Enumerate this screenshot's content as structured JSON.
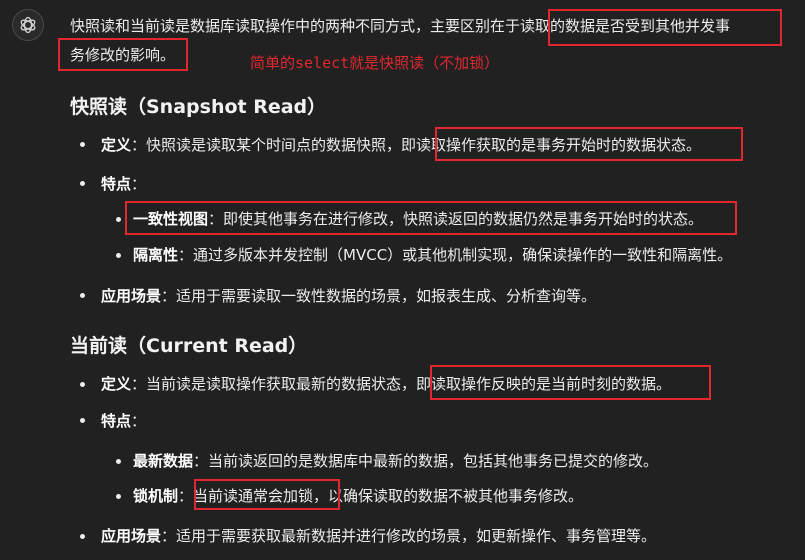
{
  "intro": {
    "line1": "快照读和当前读是数据库读取操作中的两种不同方式，主要区别在于读取的数据是否受到其他并发事",
    "line2": "务修改的影响。"
  },
  "annotation": "简单的select就是快照读（不加锁）",
  "snapshot": {
    "heading": "快照读（Snapshot Read）",
    "definition": {
      "label": "定义",
      "text": "：快照读是读取某个时间点的数据快照，即读取操作获取的是事务开始时的数据状态。"
    },
    "features": {
      "label": "特点",
      "colon": "：",
      "items": [
        {
          "label": "一致性视图",
          "text": "：即使其他事务在进行修改，快照读返回的数据仍然是事务开始时的状态。"
        },
        {
          "label": "隔离性",
          "text": "：通过多版本并发控制（MVCC）或其他机制实现，确保读操作的一致性和隔离性。"
        }
      ]
    },
    "usage": {
      "label": "应用场景",
      "text": "：适用于需要读取一致性数据的场景，如报表生成、分析查询等。"
    }
  },
  "current": {
    "heading": "当前读（Current Read）",
    "definition": {
      "label": "定义",
      "text": "：当前读是读取操作获取最新的数据状态，即读取操作反映的是当前时刻的数据。"
    },
    "features": {
      "label": "特点",
      "colon": "：",
      "items": [
        {
          "label": "最新数据",
          "text": "：当前读返回的是数据库中最新的数据，包括其他事务已提交的修改。"
        },
        {
          "label": "锁机制",
          "text": "：当前读通常会加锁，以确保读取的数据不被其他事务修改。"
        }
      ]
    },
    "usage": {
      "label": "应用场景",
      "text": "：适用于需要获取最新数据并进行修改的场景，如更新操作、事务管理等。"
    }
  }
}
